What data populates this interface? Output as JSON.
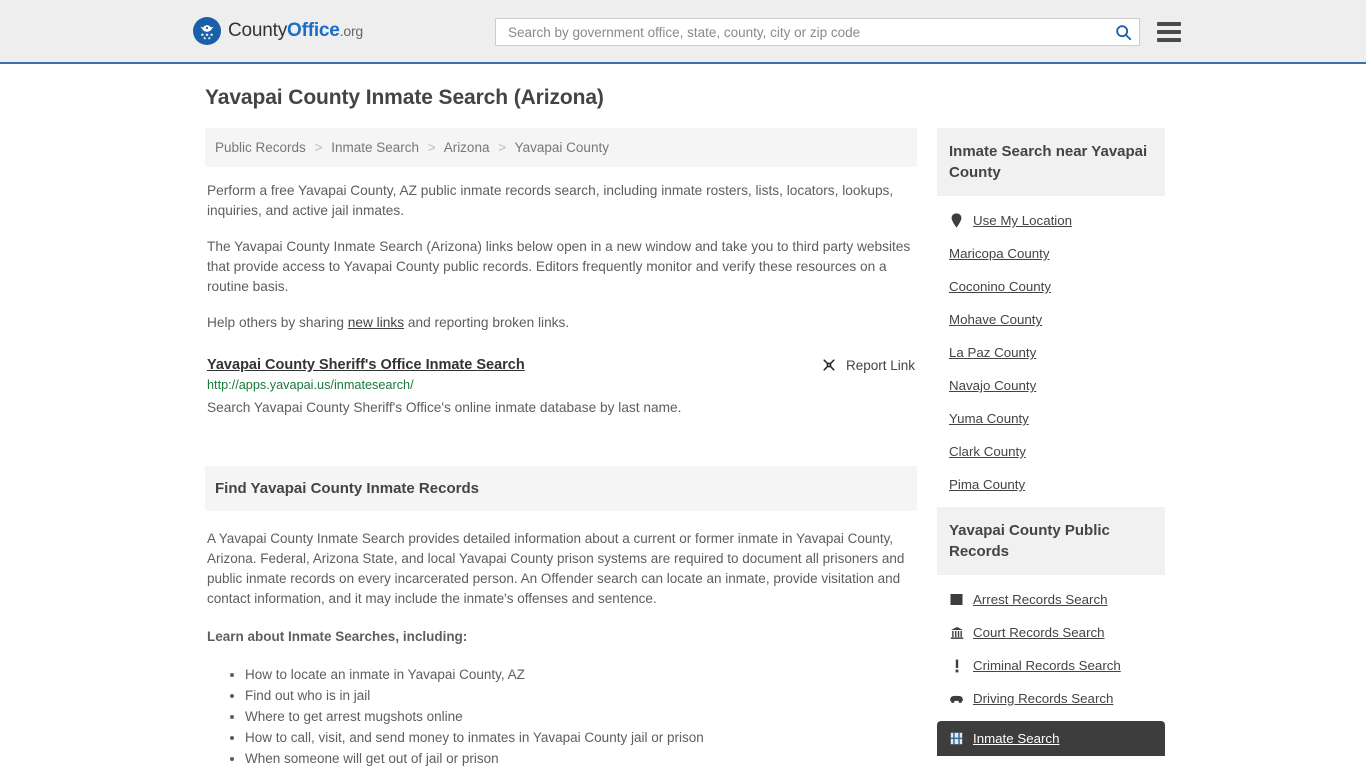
{
  "header": {
    "logo": {
      "icon": "eagle-seal-icon",
      "text_part1": "County",
      "text_part2": "Office",
      "text_part3": ".org"
    },
    "search": {
      "placeholder": "Search by government office, state, county, city or zip code",
      "value": "",
      "icon": "search-icon"
    },
    "menu_icon": "hamburger-menu-icon"
  },
  "page": {
    "title": "Yavapai County Inmate Search (Arizona)"
  },
  "breadcrumb": {
    "items": [
      {
        "label": "Public Records",
        "current": false
      },
      {
        "label": "Inmate Search",
        "current": false
      },
      {
        "label": "Arizona",
        "current": false
      },
      {
        "label": "Yavapai County",
        "current": true
      }
    ],
    "separator": ">"
  },
  "intro": {
    "paragraph1": "Perform a free Yavapai County, AZ public inmate records search, including inmate rosters, lists, locators, lookups, inquiries, and active jail inmates.",
    "paragraph2": "The Yavapai County Inmate Search (Arizona) links below open in a new window and take you to third party websites that provide access to Yavapai County public records. Editors frequently monitor and verify these resources on a routine basis.",
    "paragraph3_pre": "Help others by sharing ",
    "paragraph3_link": "new links",
    "paragraph3_post": " and reporting broken links."
  },
  "result": {
    "title": "Yavapai County Sheriff's Office Inmate Search",
    "url": "http://apps.yavapai.us/inmatesearch/",
    "description": "Search Yavapai County Sheriff's Office's online inmate database by last name.",
    "report_label": "Report Link",
    "report_icon": "broken-link-icon"
  },
  "section": {
    "heading": "Find Yavapai County Inmate Records",
    "body": "A Yavapai County Inmate Search provides detailed information about a current or former inmate in Yavapai County, Arizona. Federal, Arizona State, and local Yavapai County prison systems are required to document all prisoners and public inmate records on every incarcerated person. An Offender search can locate an inmate, provide visitation and contact information, and it may include the inmate's offenses and sentence.",
    "learn_label": "Learn about Inmate Searches, including:",
    "bullets": [
      "How to locate an inmate in Yavapai County, AZ",
      "Find out who is in jail",
      "Where to get arrest mugshots online",
      "How to call, visit, and send money to inmates in Yavapai County jail or prison",
      "When someone will get out of jail or prison"
    ]
  },
  "sidebar": {
    "near_panel": {
      "heading": "Inmate Search near Yavapai County",
      "use_location": {
        "label": "Use My Location",
        "icon": "map-pin-icon"
      },
      "counties": [
        "Maricopa County",
        "Coconino County",
        "Mohave County",
        "La Paz County",
        "Navajo County",
        "Yuma County",
        "Clark County",
        "Pima County"
      ]
    },
    "records_panel": {
      "heading": "Yavapai County Public Records",
      "items": [
        {
          "label": "Arrest Records Search",
          "icon": "fingerprint-icon",
          "active": false
        },
        {
          "label": "Court Records Search",
          "icon": "courthouse-icon",
          "active": false
        },
        {
          "label": "Criminal Records Search",
          "icon": "exclamation-icon",
          "active": false
        },
        {
          "label": "Driving Records Search",
          "icon": "car-icon",
          "active": false
        },
        {
          "label": "Inmate Search",
          "icon": "jail-door-icon",
          "active": true
        }
      ]
    }
  },
  "colors": {
    "header_bg": "#eeeeee",
    "header_border": "#3973ac",
    "brand_blue": "#1a6fc4",
    "url_green": "#1a7a3c",
    "panel_gray": "#f1f1f1",
    "active_dark": "#3d3d3d"
  }
}
